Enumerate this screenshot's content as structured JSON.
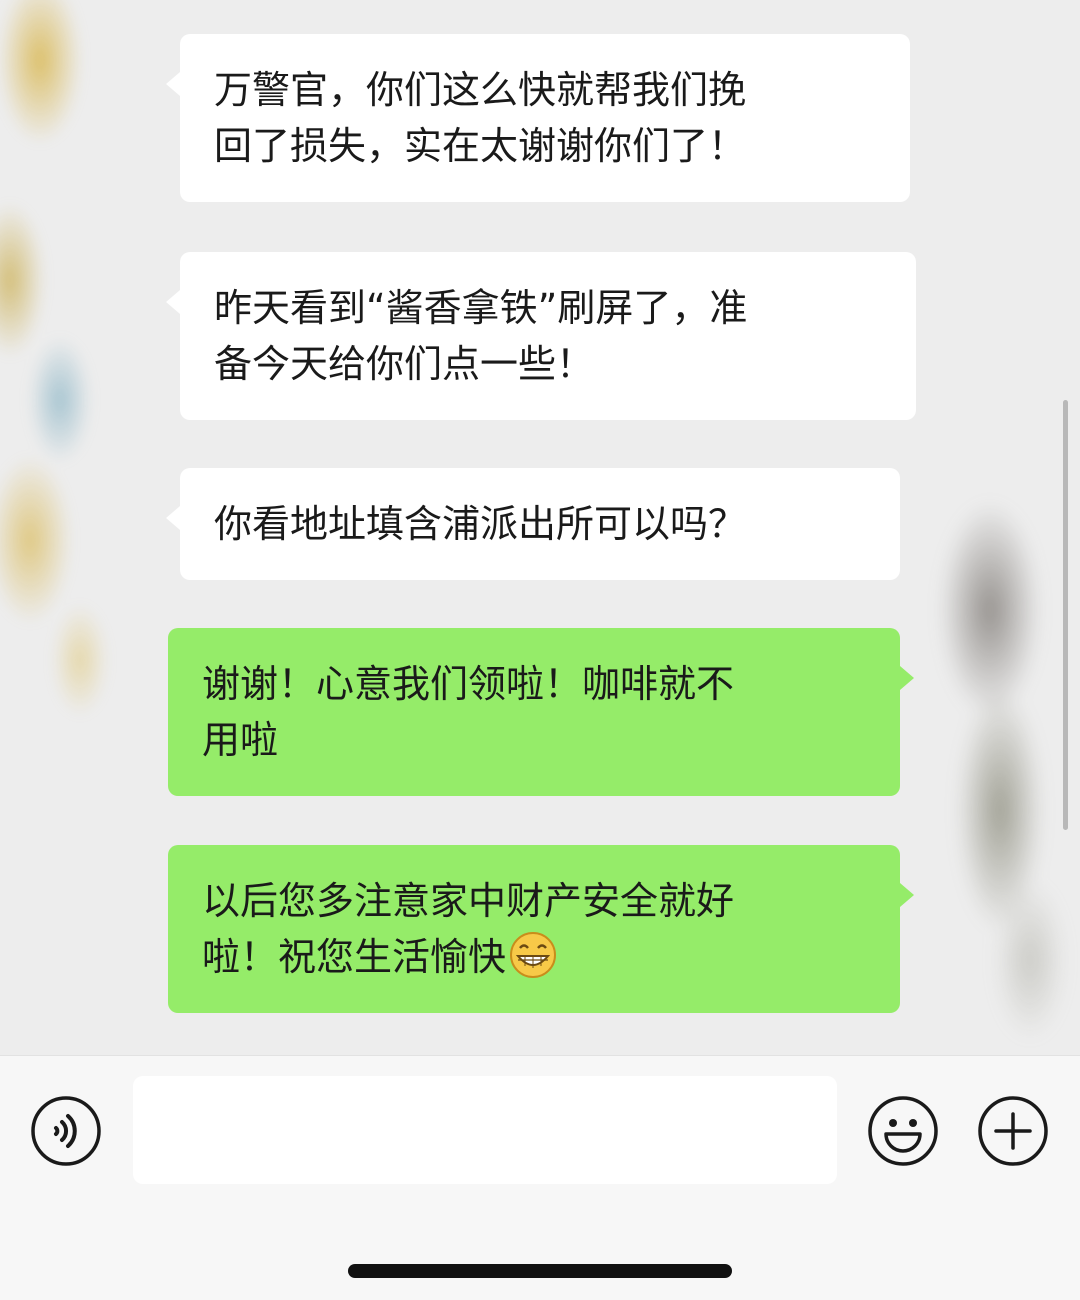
{
  "messages": [
    {
      "side": "in",
      "lines": [
        "万警官，你们这么快就帮我们挽",
        "回了损失，实在太谢谢你们了！"
      ]
    },
    {
      "side": "in",
      "lines": [
        "昨天看到“酱香拿铁”刷屏了，准",
        "备今天给你们点一些！"
      ]
    },
    {
      "side": "in",
      "lines": [
        "你看地址填含浦派出所可以吗？"
      ]
    },
    {
      "side": "out",
      "lines": [
        "谢谢！心意我们领啦！咖啡就不",
        "用啦"
      ]
    },
    {
      "side": "out",
      "lines": [
        "以后您多注意家中财产安全就好",
        "啦！祝您生活愉快"
      ],
      "trailing_emoji": "grinning-face-emoji"
    }
  ],
  "input_bar": {
    "placeholder": "",
    "icons": [
      "voice-icon",
      "emoji-icon",
      "plus-icon"
    ]
  },
  "colors": {
    "chat_background": "#ededed",
    "incoming_bubble": "#ffffff",
    "outgoing_bubble": "#95ec69",
    "input_bar_background": "#f7f7f7"
  }
}
